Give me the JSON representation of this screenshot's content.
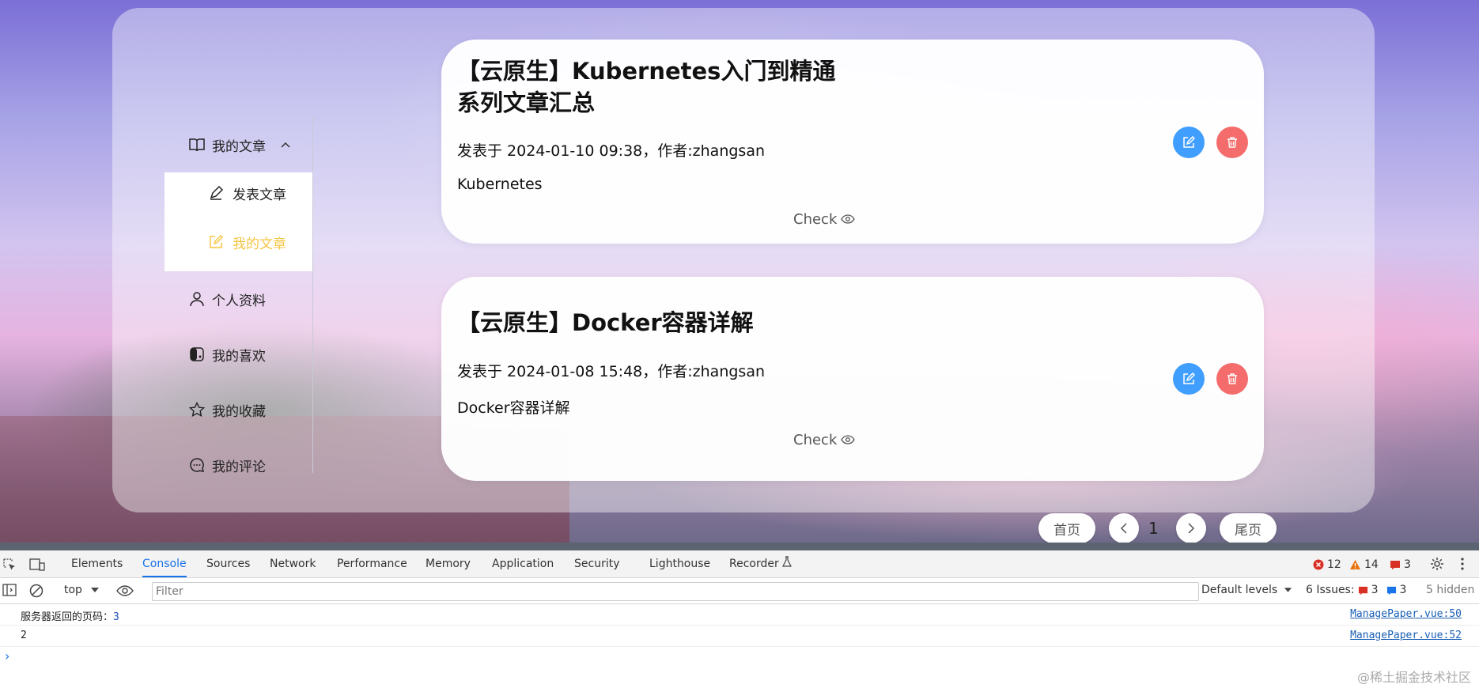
{
  "sidebar": {
    "group_label": "我的文章",
    "sub_items": [
      {
        "label": "发表文章",
        "active": false
      },
      {
        "label": "我的文章",
        "active": true
      }
    ],
    "items": [
      {
        "label": "个人资料",
        "icon": "user-icon"
      },
      {
        "label": "我的喜欢",
        "icon": "switch-icon"
      },
      {
        "label": "我的收藏",
        "icon": "star-icon"
      },
      {
        "label": "我的评论",
        "icon": "comment-icon"
      }
    ]
  },
  "articles": [
    {
      "title_line1": "【云原生】Kubernetes入门到精通",
      "title_line2": "系列文章汇总",
      "meta": "发表于 2024-01-10 09:38，作者:zhangsan",
      "summary": "Kubernetes",
      "check_label": "Check"
    },
    {
      "title_line1": "【云原生】Docker容器详解",
      "meta": "发表于 2024-01-08 15:48，作者:zhangsan",
      "summary": "Docker容器详解",
      "check_label": "Check"
    }
  ],
  "pagination": {
    "first_label": "首页",
    "current_page": "1",
    "last_label": "尾页"
  },
  "devtools": {
    "tabs": [
      "Elements",
      "Console",
      "Sources",
      "Network",
      "Performance",
      "Memory",
      "Application",
      "Security",
      "Lighthouse",
      "Recorder"
    ],
    "active_tab": "Console",
    "errors": "12",
    "warnings": "14",
    "issues_badge": "3",
    "context": "top",
    "filter_placeholder": "Filter",
    "levels": "Default levels",
    "issues_label": "6 Issues:",
    "issues_red": "3",
    "issues_blue": "3",
    "hidden": "5 hidden",
    "logs": [
      {
        "text": "服务器返回的页码：",
        "value": "3",
        "source": "ManagePaper.vue:50"
      },
      {
        "text": "2",
        "value": "",
        "source": "ManagePaper.vue:52"
      }
    ],
    "prompt": "›"
  },
  "watermark": "@稀土掘金技术社区",
  "colors": {
    "accent": "#f5c542",
    "edit": "#409eff",
    "delete": "#f56c6c",
    "devtools_active": "#1a73e8"
  }
}
